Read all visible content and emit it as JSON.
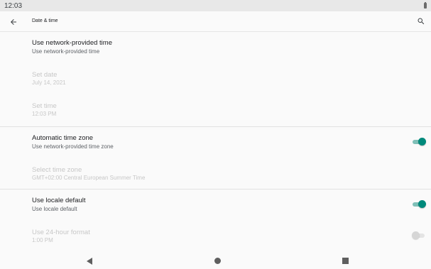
{
  "status_bar": {
    "time": "12:03"
  },
  "app_bar": {
    "title": "Date & time"
  },
  "settings": {
    "network_time": {
      "title": "Use network-provided time",
      "summary": "Use network-provided time"
    },
    "set_date": {
      "title": "Set date",
      "summary": "July 14, 2021"
    },
    "set_time": {
      "title": "Set time",
      "summary": "12:03 PM"
    },
    "auto_timezone": {
      "title": "Automatic time zone",
      "summary": "Use network-provided time zone",
      "enabled": true
    },
    "select_timezone": {
      "title": "Select time zone",
      "summary": "GMT+02:00 Central European Summer Time"
    },
    "locale_default": {
      "title": "Use locale default",
      "summary": "Use locale default",
      "enabled": true
    },
    "hour_24": {
      "title": "Use 24-hour format",
      "summary": "1:00 PM",
      "enabled": false
    }
  },
  "colors": {
    "accent": "#00897b",
    "accent_track": "#7fbfb7",
    "disabled_text": "#c7c7c7"
  },
  "icons": {
    "back": "arrow-back-icon",
    "search": "search-icon",
    "nav_back": "triangle-back-icon",
    "nav_home": "circle-home-icon",
    "nav_recents": "square-recents-icon"
  }
}
